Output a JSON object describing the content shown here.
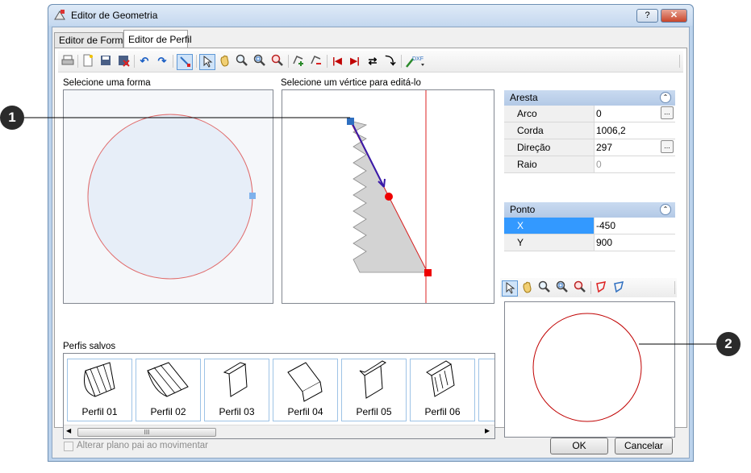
{
  "window": {
    "title": "Editor de Geometria",
    "help_label": "?",
    "close_label": "✕"
  },
  "tabs": [
    {
      "label": "Editor de Forma"
    },
    {
      "label": "Editor de Perfil"
    }
  ],
  "toolbar": {
    "dxf_label": "DXF"
  },
  "shape_panel": {
    "label": "Selecione uma forma"
  },
  "vertex_panel": {
    "label": "Selecione um vértice para editá-lo"
  },
  "properties": {
    "aresta": {
      "header": "Aresta",
      "rows": [
        {
          "name": "Arco",
          "value": "0",
          "has_button": true
        },
        {
          "name": "Corda",
          "value": "1006,2"
        },
        {
          "name": "Direção",
          "value": "297",
          "has_button": true
        },
        {
          "name": "Raio",
          "value": "0",
          "disabled": true
        }
      ]
    },
    "ponto": {
      "header": "Ponto",
      "rows": [
        {
          "name": "X",
          "value": "-450",
          "selected": true
        },
        {
          "name": "Y",
          "value": "900"
        }
      ]
    },
    "dots_label": "..."
  },
  "saved_profiles": {
    "label": "Perfis salvos",
    "items": [
      "Perfil 01",
      "Perfil 02",
      "Perfil 03",
      "Perfil 04",
      "Perfil 05",
      "Perfil 06"
    ],
    "scroll_grip": "III"
  },
  "footer": {
    "checkbox_label": "Alterar plano pai ao movimentar",
    "ok_label": "OK",
    "cancel_label": "Cancelar"
  },
  "callouts": [
    "1",
    "2"
  ],
  "colors": {
    "accent": "#3399ff",
    "header_blue": "#c9daf0",
    "profile_red": "#ff0000",
    "handle_blue": "#2f6fc0"
  }
}
